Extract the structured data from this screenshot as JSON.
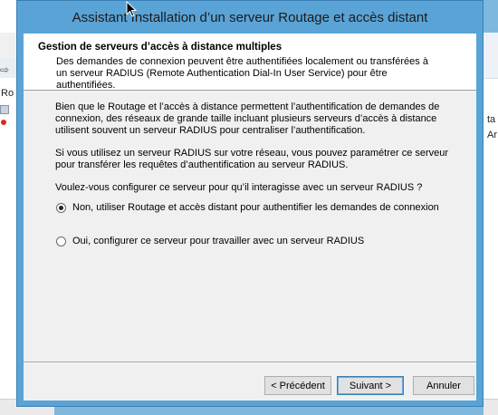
{
  "dialog": {
    "title": "Assistant Installation d’un serveur Routage et accès distant"
  },
  "header": {
    "title": "Gestion de serveurs d’accès à distance multiples",
    "description": "Des demandes de connexion peuvent être authentifiées localement ou transférées à un serveur RADIUS (Remote Authentication Dial-In User Service) pour être authentifiées."
  },
  "body": {
    "paragraph1": "Bien que le Routage et l’accès à distance permettent l’authentification de demandes de connexion, des réseaux de grande taille incluant plusieurs serveurs d’accès à distance utilisent souvent un serveur RADIUS pour centraliser l’authentification.",
    "paragraph2": "Si vous utilisez un serveur RADIUS sur votre réseau, vous pouvez paramétrer ce serveur pour transférer les requêtes d’authentification au serveur RADIUS.",
    "question": "Voulez-vous configurer ce serveur pour qu’il interagisse avec un serveur RADIUS ?",
    "options": [
      {
        "label": "Non, utiliser Routage et accès distant pour authentifier les demandes de connexion",
        "selected": true
      },
      {
        "label": "Oui, configurer ce serveur pour travailler avec un serveur RADIUS",
        "selected": false
      }
    ]
  },
  "buttons": {
    "back": "< Précédent",
    "next": "Suivant >",
    "cancel": "Annuler"
  },
  "background": {
    "left_text": "Ro",
    "right_text1": "ta",
    "right_text2": "Ar"
  },
  "colors": {
    "titlebar": "#5aa3d6",
    "desktop": "#7fb8de",
    "client": "#f0f0f0"
  }
}
